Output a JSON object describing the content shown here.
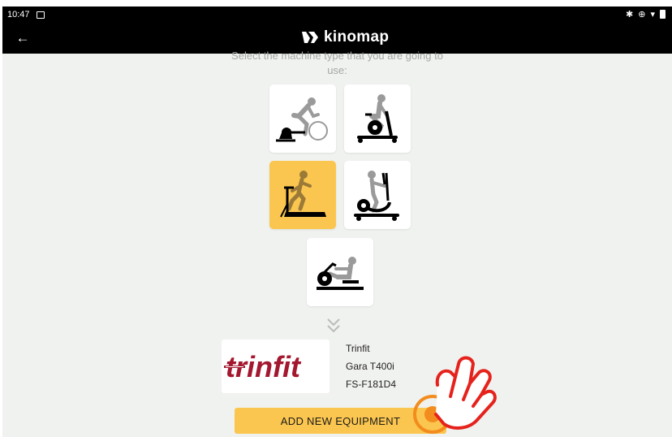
{
  "status_bar": {
    "time": "10:47"
  },
  "app_bar": {
    "back_icon": "arrow-left-icon",
    "brand": "kinomap"
  },
  "instruction": {
    "line1": "Select the machine type that you are going to",
    "line2": "use:"
  },
  "machines": [
    {
      "id": "home-trainer",
      "icon": "home-trainer-icon",
      "selected": false
    },
    {
      "id": "exercise-bike",
      "icon": "exercise-bike-icon",
      "selected": false
    },
    {
      "id": "treadmill",
      "icon": "treadmill-icon",
      "selected": true
    },
    {
      "id": "elliptical",
      "icon": "elliptical-icon",
      "selected": false
    },
    {
      "id": "rower",
      "icon": "rower-icon",
      "selected": false
    }
  ],
  "equipment": {
    "logo_text": "trinfit",
    "brand": "Trinfit",
    "model": "Gara T400i",
    "device_id": "FS-F181D4"
  },
  "add_button": {
    "label": "ADD NEW EQUIPMENT"
  },
  "colors": {
    "accent": "#fbc64f",
    "trinfit_red": "#a3172f",
    "hand_red": "#e5231c",
    "hand_orange": "#f28c1e"
  }
}
